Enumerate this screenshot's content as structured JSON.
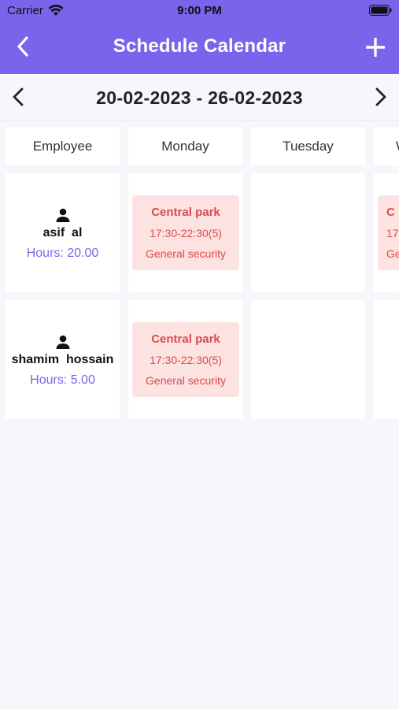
{
  "status_bar": {
    "carrier": "Carrier",
    "time": "9:00 PM"
  },
  "nav": {
    "title": "Schedule Calendar",
    "back_icon": "chevron-left-icon",
    "add_icon": "plus-icon"
  },
  "week": {
    "range": "20-02-2023 - 26-02-2023"
  },
  "columns": [
    "Employee",
    "Monday",
    "Tuesday",
    "W"
  ],
  "employees": [
    {
      "name": "asif  al",
      "hours": "Hours: 20.00",
      "shift_monday": {
        "location": "Central park",
        "time": "17:30-22:30(5)",
        "role": "General security"
      },
      "shift_wednesday": {
        "location": "C",
        "time": "17",
        "role": "Ge"
      }
    },
    {
      "name": "shamim  hossain",
      "hours": "Hours: 5.00",
      "shift_monday": {
        "location": "Central park",
        "time": "17:30-22:30(5)",
        "role": "General security"
      }
    }
  ],
  "colors": {
    "accent": "#7c63ec",
    "shift_bg": "#fde2e2",
    "shift_text": "#dd4b4b",
    "background": "#f7f6fb"
  }
}
